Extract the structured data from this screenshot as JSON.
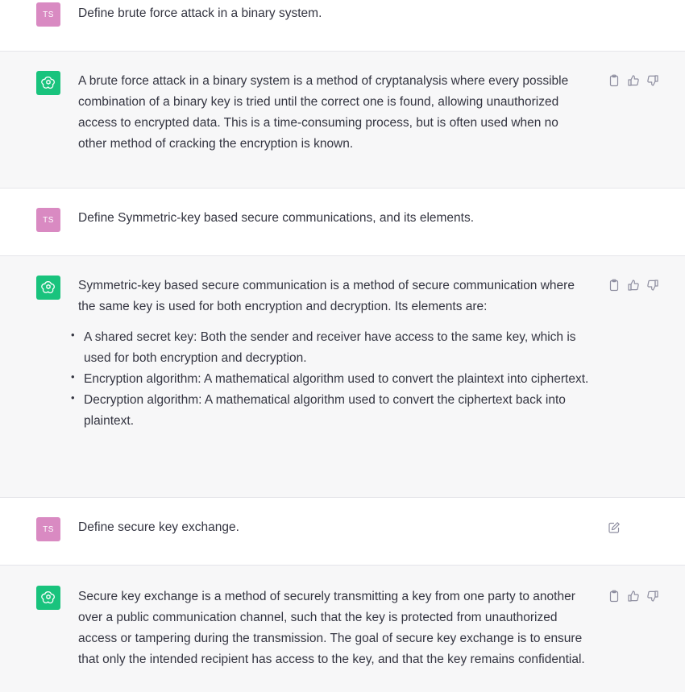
{
  "user": {
    "avatar_initials": "TS",
    "avatar_color": "#d98ac2"
  },
  "assistant": {
    "avatar_color": "#19c37d"
  },
  "messages": [
    {
      "role": "user",
      "text": "Define brute force attack in a binary system."
    },
    {
      "role": "assistant",
      "text": "A brute force attack in a binary system is a method of cryptanalysis where every possible combination of a binary key is tried until the correct one is found, allowing unauthorized access to encrypted data. This is a time-consuming process, but is often used when no other method of cracking the encryption is known.",
      "actions": [
        "copy-icon",
        "thumbs-up-icon",
        "thumbs-down-icon"
      ]
    },
    {
      "role": "user",
      "text": "Define Symmetric-key based secure communications, and its elements."
    },
    {
      "role": "assistant",
      "text": "Symmetric-key based secure communication is a method of secure communication where the same key is used for both encryption and decryption. Its elements are:",
      "bullets": [
        "A shared secret key: Both the sender and receiver have access to the same key, which is used for both encryption and decryption.",
        "Encryption algorithm: A mathematical algorithm used to convert the plaintext into ciphertext.",
        "Decryption algorithm: A mathematical algorithm used to convert the ciphertext back into plaintext."
      ],
      "actions": [
        "copy-icon",
        "thumbs-up-icon",
        "thumbs-down-icon"
      ]
    },
    {
      "role": "user",
      "text": "Define secure key exchange.",
      "actions": [
        "edit-icon"
      ]
    },
    {
      "role": "assistant",
      "text": "Secure key exchange is a method of securely transmitting a key from one party to another over a public communication channel, such that the key is protected from unauthorized access or tampering during the transmission. The goal of secure key exchange is to ensure that only the intended recipient has access to the key, and that the key remains confidential.",
      "actions": [
        "copy-icon",
        "thumbs-up-icon",
        "thumbs-down-icon"
      ]
    }
  ]
}
